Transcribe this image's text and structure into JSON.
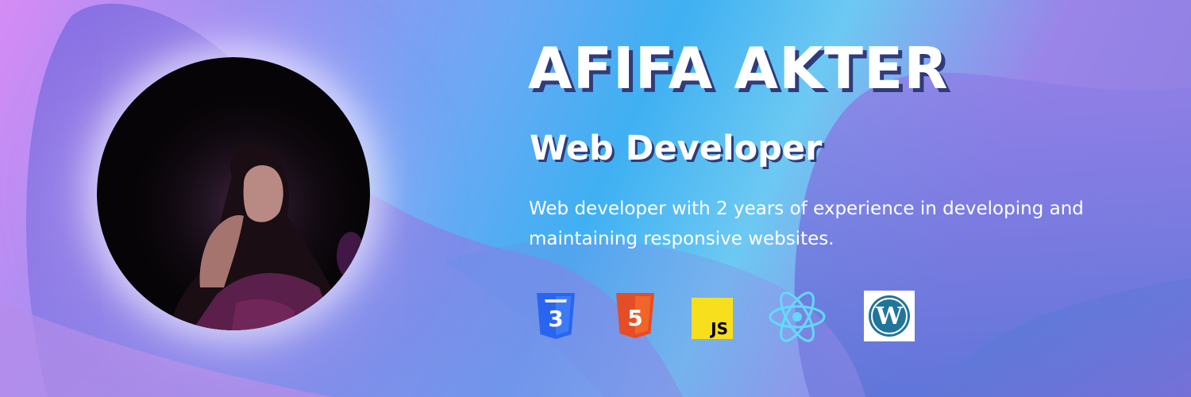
{
  "profile": {
    "name": "AFIFA AKTER",
    "role": "Web Developer",
    "summary": "Web developer with 2 years of experience in developing and maintaining responsive websites."
  },
  "skills": [
    {
      "name": "css3-icon",
      "label": "3",
      "color": "#2965f1"
    },
    {
      "name": "html5-icon",
      "label": "5",
      "color": "#e44d26"
    },
    {
      "name": "javascript-icon",
      "label": "JS",
      "color": "#f7df1e"
    },
    {
      "name": "react-icon",
      "color": "#61dafb"
    },
    {
      "name": "wordpress-icon",
      "color": "#21759b"
    }
  ],
  "colors": {
    "text": "#ffffff",
    "shadow": "#2f3b7a"
  }
}
